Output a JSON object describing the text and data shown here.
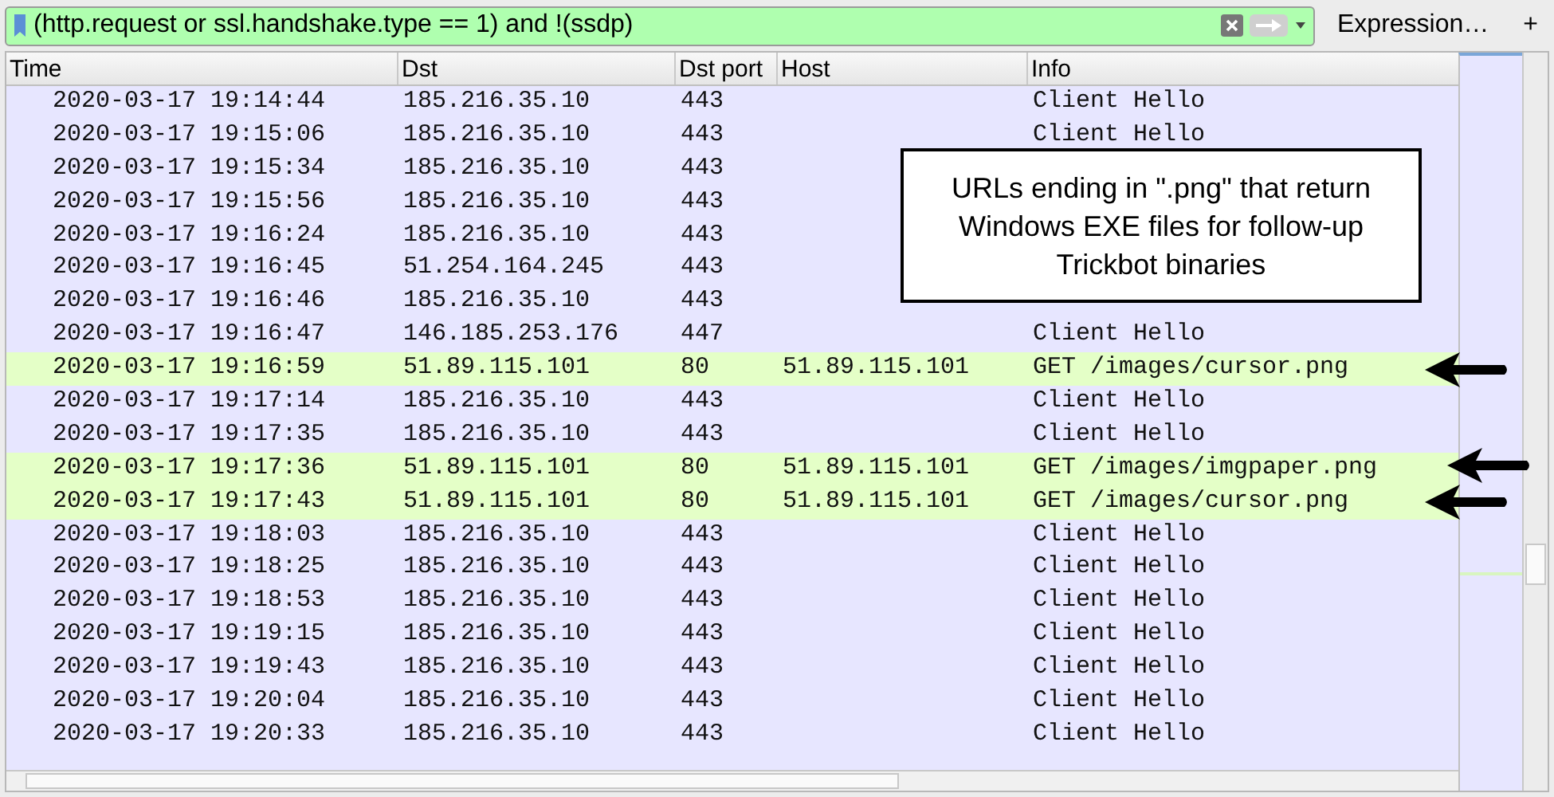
{
  "filter": {
    "value": "(http.request or ssl.handshake.type == 1) and !(ssdp)"
  },
  "expression_button": "Expression…",
  "add_button": "+",
  "columns": [
    "Time",
    "Dst",
    "Dst port",
    "Host",
    "Info"
  ],
  "rows": [
    {
      "cells": [
        "2020-03-17 19:14:44",
        "185.216.35.10",
        "443",
        "",
        "Client Hello"
      ],
      "color": "#e7e6ff"
    },
    {
      "cells": [
        "2020-03-17 19:15:06",
        "185.216.35.10",
        "443",
        "",
        "Client Hello"
      ],
      "color": "#e7e6ff"
    },
    {
      "cells": [
        "2020-03-17 19:15:34",
        "185.216.35.10",
        "443",
        "",
        ""
      ],
      "color": "#e7e6ff"
    },
    {
      "cells": [
        "2020-03-17 19:15:56",
        "185.216.35.10",
        "443",
        "",
        ""
      ],
      "color": "#e7e6ff"
    },
    {
      "cells": [
        "2020-03-17 19:16:24",
        "185.216.35.10",
        "443",
        "",
        ""
      ],
      "color": "#e7e6ff"
    },
    {
      "cells": [
        "2020-03-17 19:16:45",
        "51.254.164.245",
        "443",
        "",
        ""
      ],
      "color": "#e7e6ff"
    },
    {
      "cells": [
        "2020-03-17 19:16:46",
        "185.216.35.10",
        "443",
        "",
        ""
      ],
      "color": "#e7e6ff"
    },
    {
      "cells": [
        "2020-03-17 19:16:47",
        "146.185.253.176",
        "447",
        "",
        "Client Hello"
      ],
      "color": "#e7e6ff"
    },
    {
      "cells": [
        "2020-03-17 19:16:59",
        "51.89.115.101",
        "80",
        "51.89.115.101",
        "GET /images/cursor.png"
      ],
      "color": "#e4ffc7"
    },
    {
      "cells": [
        "2020-03-17 19:17:14",
        "185.216.35.10",
        "443",
        "",
        "Client Hello"
      ],
      "color": "#e7e6ff"
    },
    {
      "cells": [
        "2020-03-17 19:17:35",
        "185.216.35.10",
        "443",
        "",
        "Client Hello"
      ],
      "color": "#e7e6ff"
    },
    {
      "cells": [
        "2020-03-17 19:17:36",
        "51.89.115.101",
        "80",
        "51.89.115.101",
        "GET /images/imgpaper.png"
      ],
      "color": "#e4ffc7"
    },
    {
      "cells": [
        "2020-03-17 19:17:43",
        "51.89.115.101",
        "80",
        "51.89.115.101",
        "GET /images/cursor.png"
      ],
      "color": "#e4ffc7"
    },
    {
      "cells": [
        "2020-03-17 19:18:03",
        "185.216.35.10",
        "443",
        "",
        "Client Hello"
      ],
      "color": "#e7e6ff"
    },
    {
      "cells": [
        "2020-03-17 19:18:25",
        "185.216.35.10",
        "443",
        "",
        "Client Hello"
      ],
      "color": "#e7e6ff"
    },
    {
      "cells": [
        "2020-03-17 19:18:53",
        "185.216.35.10",
        "443",
        "",
        "Client Hello"
      ],
      "color": "#e7e6ff"
    },
    {
      "cells": [
        "2020-03-17 19:19:15",
        "185.216.35.10",
        "443",
        "",
        "Client Hello"
      ],
      "color": "#e7e6ff"
    },
    {
      "cells": [
        "2020-03-17 19:19:43",
        "185.216.35.10",
        "443",
        "",
        "Client Hello"
      ],
      "color": "#e7e6ff"
    },
    {
      "cells": [
        "2020-03-17 19:20:04",
        "185.216.35.10",
        "443",
        "",
        "Client Hello"
      ],
      "color": "#e7e6ff"
    },
    {
      "cells": [
        "2020-03-17 19:20:33",
        "185.216.35.10",
        "443",
        "",
        "Client Hello"
      ],
      "color": "#e7e6ff"
    }
  ],
  "callout": "URLs ending in \".png\" that return Windows EXE files for follow-up Trickbot binaries"
}
